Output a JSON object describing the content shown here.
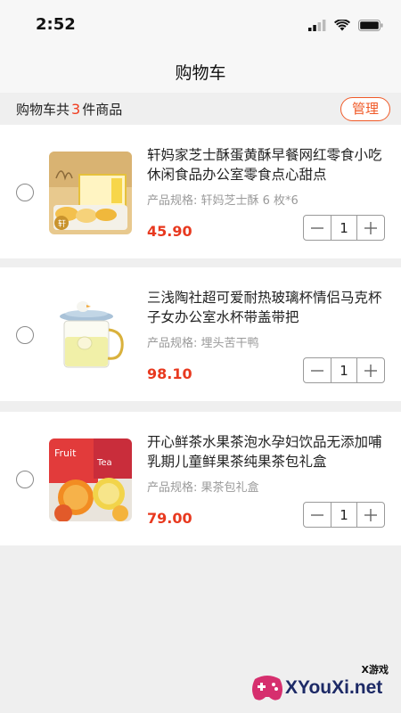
{
  "status_bar": {
    "time": "2:52"
  },
  "nav": {
    "title": "购物车"
  },
  "summary": {
    "prefix": "购物车共",
    "count": "3",
    "suffix": "件商品",
    "manage_label": "管理"
  },
  "items": [
    {
      "title": "轩妈家芝士酥蛋黄酥早餐网红零食小吃休闲食品办公室零食点心甜点",
      "spec": "产品规格: 轩妈芝士酥 6 枚*6",
      "price": "45.90",
      "quantity": "1"
    },
    {
      "title": "三浅陶社超可爱耐热玻璃杯情侣马克杯子女办公室水杯带盖带把",
      "spec": "产品规格: 埋头苦干鸭",
      "price": "98.10",
      "quantity": "1"
    },
    {
      "title": "开心鲜茶水果茶泡水孕妇饮品无添加哺乳期儿童鲜果茶纯果茶包礼盒",
      "spec": "产品规格: 果茶包礼盒",
      "price": "79.00",
      "quantity": "1"
    }
  ],
  "watermark": {
    "text": "XYouXi.net",
    "sub": "X游戏"
  },
  "colors": {
    "accent": "#e8391f",
    "manage_border": "#f05a28",
    "background": "#efefef"
  }
}
